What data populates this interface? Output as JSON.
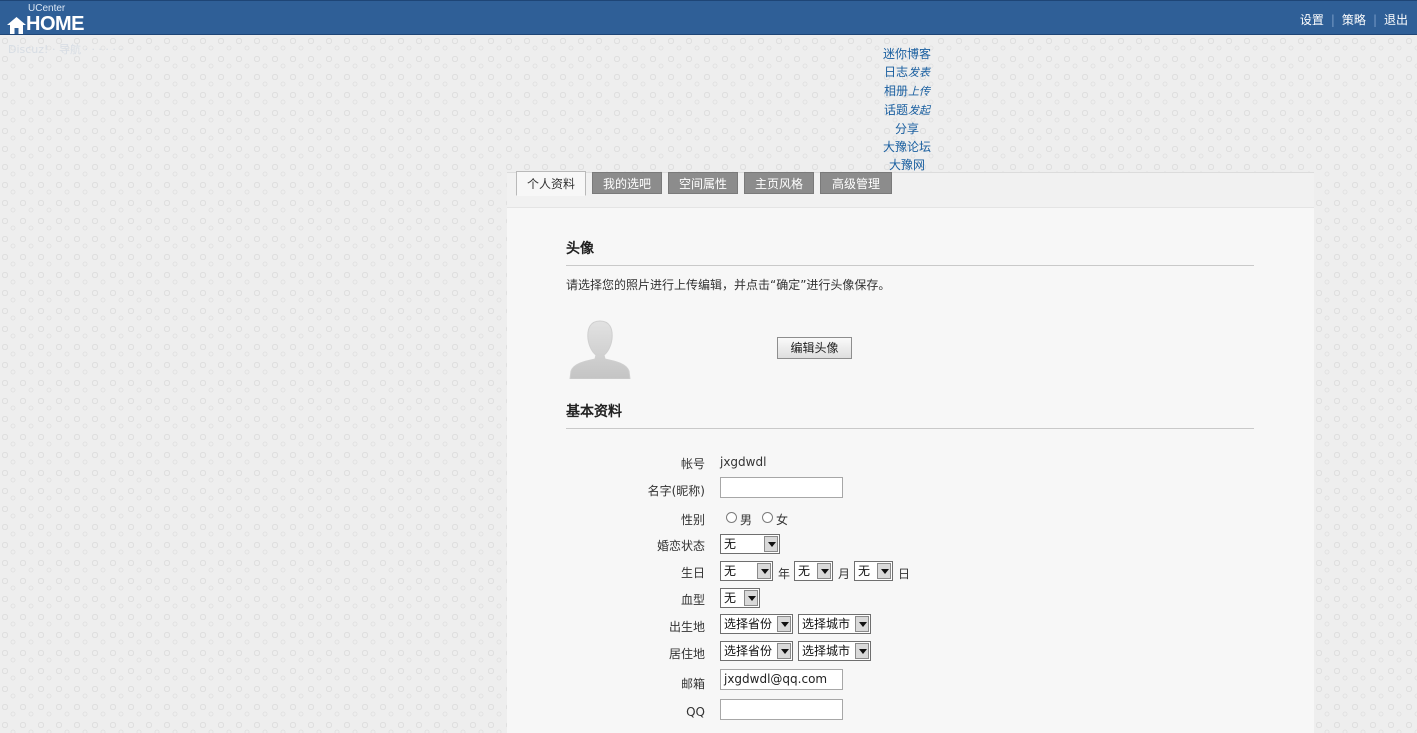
{
  "header": {
    "logo_small": "UCenter",
    "logo_big": "HOME",
    "nav": [
      {
        "label": "设置"
      },
      {
        "label": "策略"
      },
      {
        "label": "退出"
      }
    ]
  },
  "faint_line": "Discuz! · 导航 · · · · · ·",
  "quicklinks": [
    {
      "label": "迷你博客",
      "action": ""
    },
    {
      "label": "日志",
      "action": "发表"
    },
    {
      "label": "相册",
      "action": "上传"
    },
    {
      "label": "话题",
      "action": "发起"
    },
    {
      "label": "分享",
      "action": ""
    },
    {
      "label": "大豫论坛",
      "action": ""
    },
    {
      "label": "大豫网",
      "action": ""
    }
  ],
  "tabs": [
    {
      "label": "个人资料",
      "active": true
    },
    {
      "label": "我的选吧",
      "active": false
    },
    {
      "label": "空间属性",
      "active": false
    },
    {
      "label": "主页风格",
      "active": false
    },
    {
      "label": "高级管理",
      "active": false
    }
  ],
  "avatar_section": {
    "title": "头像",
    "hint": "请选择您的照片进行上传编辑，并点击“确定”进行头像保存。",
    "edit_button": "编辑头像"
  },
  "basic_section": {
    "title": "基本资料",
    "account_label": "帐号",
    "account_value": "jxgdwdl",
    "name_label": "名字(昵称)",
    "name_value": "",
    "gender_label": "性别",
    "gender_options": [
      "男",
      "女"
    ],
    "marital_label": "婚恋状态",
    "marital_value": "无",
    "birthday_label": "生日",
    "birthday_year": "无",
    "birthday_month": "无",
    "birthday_day": "无",
    "unit_year": "年",
    "unit_month": "月",
    "unit_day": "日",
    "blood_label": "血型",
    "blood_value": "无",
    "birthplace_label": "出生地",
    "birthplace_province": "选择省份",
    "birthplace_city": "选择城市",
    "residence_label": "居住地",
    "residence_province": "选择省份",
    "residence_city": "选择城市",
    "email_label": "邮箱",
    "email_value": "jxgdwdl@qq.com",
    "qq_label": "QQ",
    "qq_value": ""
  },
  "colors": {
    "header_bg": "#2f5f97",
    "link": "#1a5fa0",
    "tab_inactive": "#8c8c8c"
  }
}
